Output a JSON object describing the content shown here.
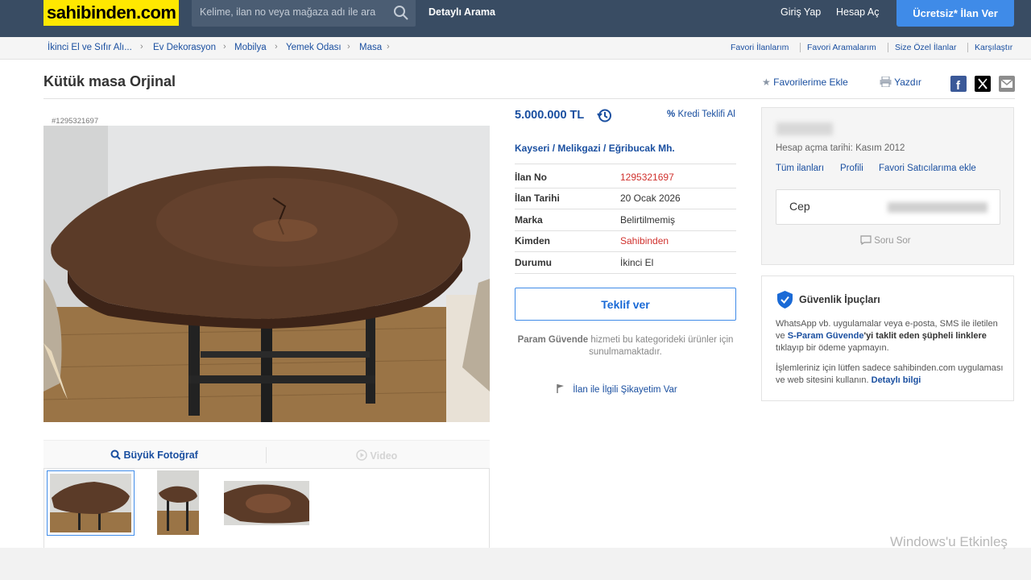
{
  "header": {
    "logo": "sahibinden.com",
    "search_placeholder": "Kelime, ilan no veya mağaza adı ile ara",
    "advanced_search": "Detaylı Arama",
    "login": "Giriş Yap",
    "register": "Hesap Aç",
    "post_ad": "Ücretsiz* İlan Ver"
  },
  "breadcrumb": {
    "items": [
      "İkinci El ve Sıfır Alı...",
      "Ev Dekorasyon",
      "Mobilya",
      "Yemek Odası",
      "Masa"
    ],
    "right_links": [
      "Favori İlanlarım",
      "Favori Aramalarım",
      "Size Özel İlanlar",
      "Karşılaştır"
    ]
  },
  "listing": {
    "title": "Kütük masa Orjinal",
    "add_favorites": "Favorilerime Ekle",
    "print": "Yazdır",
    "listing_id_tag": "#1295321697",
    "price": "5.000.000 TL",
    "credit_offer": "Kredi Teklifi Al",
    "location": "Kayseri  /  Melikgazi  /  Eğribucak Mh.",
    "details": [
      {
        "label": "İlan No",
        "value": "1295321697",
        "highlight": true
      },
      {
        "label": "İlan Tarihi",
        "value": "20 Ocak 2026",
        "highlight": false
      },
      {
        "label": "Marka",
        "value": "Belirtilmemiş",
        "highlight": false
      },
      {
        "label": "Kimden",
        "value": "Sahibinden",
        "highlight": true
      },
      {
        "label": "Durumu",
        "value": "İkinci El",
        "highlight": false
      }
    ],
    "offer_button": "Teklif ver",
    "param_note_bold": "Param Güvende",
    "param_note_rest": " hizmeti bu kategorideki ürünler için sunulmamaktadır.",
    "complaint": "İlan ile İlgili Şikayetim Var"
  },
  "gallery": {
    "big_photo_tab": "Büyük Fotoğraf",
    "video_tab": "Video"
  },
  "seller": {
    "account_date": "Hesap açma tarihi: Kasım 2012",
    "links": [
      "Tüm ilanları",
      "Profili",
      "Favori Satıcılarıma ekle"
    ],
    "phone_label": "Cep",
    "ask_question": "Soru Sor"
  },
  "tips": {
    "title": "Güvenlik İpuçları",
    "p1_a": "WhatsApp vb. uygulamalar veya e-posta, SMS ile iletilen ve ",
    "p1_b": "S-Param Güvende",
    "p1_c": "'yi taklit eden şüpheli linklere",
    "p1_d": " tıklayıp bir ödeme yapmayın.",
    "p2_a": "İşlemleriniz için lütfen sadece sahibinden.com uygulaması ve web sitesini kullanın. ",
    "p2_b": "Detaylı bilgi"
  },
  "os_watermark": "Windows'u Etkinleş",
  "colors": {
    "header_bg": "#394c63",
    "logo_bg": "#ffe800",
    "accent_blue": "#3f8be8",
    "link_blue": "#1a4fa0",
    "highlight_red": "#d0312d"
  }
}
